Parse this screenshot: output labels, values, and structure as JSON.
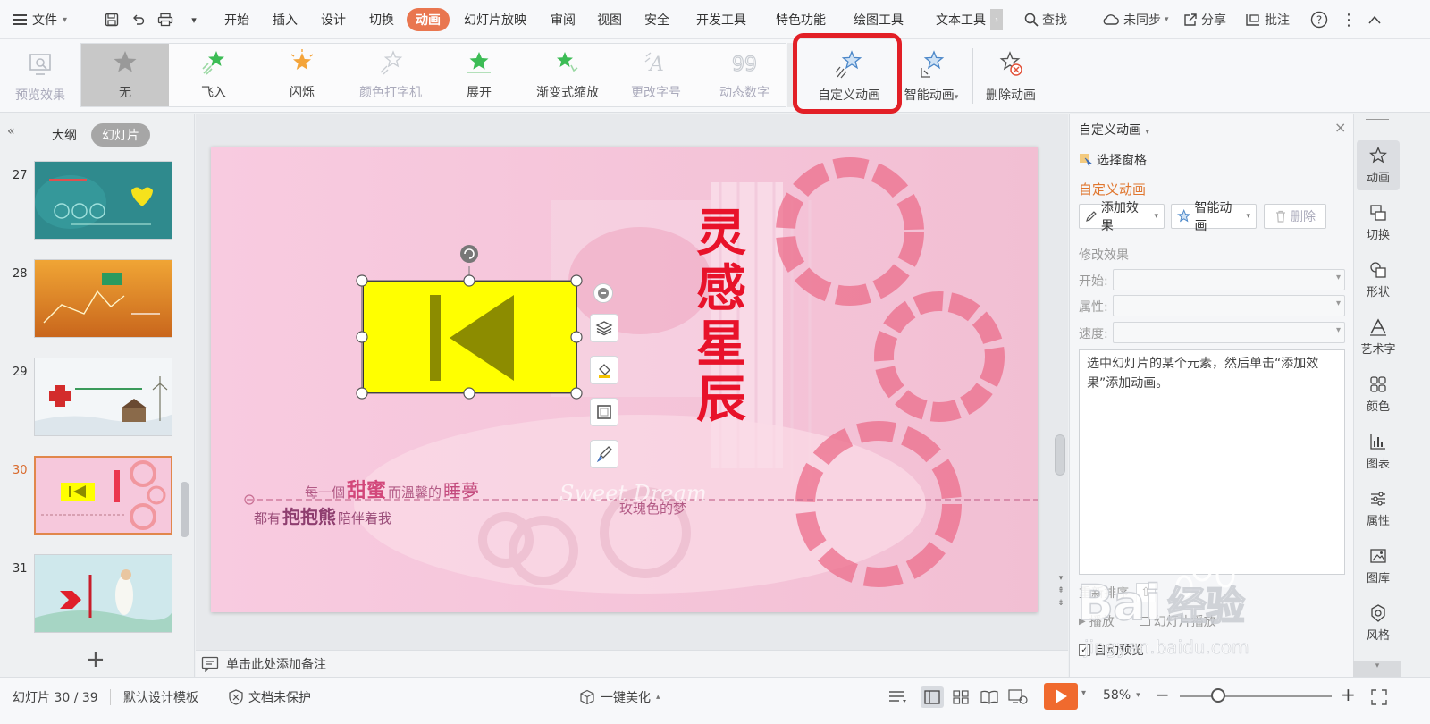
{
  "menubar": {
    "file_label": "文件",
    "tabs": [
      {
        "label": "开始",
        "active": false
      },
      {
        "label": "插入",
        "active": false
      },
      {
        "label": "设计",
        "active": false
      },
      {
        "label": "切换",
        "active": false
      },
      {
        "label": "动画",
        "active": true
      },
      {
        "label": "幻灯片放映",
        "active": false
      },
      {
        "label": "审阅",
        "active": false
      },
      {
        "label": "视图",
        "active": false
      },
      {
        "label": "安全",
        "active": false
      },
      {
        "label": "开发工具",
        "active": false
      },
      {
        "label": "特色功能",
        "active": false
      },
      {
        "label": "绘图工具",
        "active": false
      },
      {
        "label": "文本工具",
        "active": false
      }
    ],
    "search_label": "查找",
    "sync_label": "未同步",
    "share_label": "分享",
    "comment_label": "批注"
  },
  "ribbon": {
    "preview_label": "预览效果",
    "effects": [
      {
        "label": "无",
        "selected": true,
        "enabled": true
      },
      {
        "label": "飞入",
        "selected": false,
        "enabled": true
      },
      {
        "label": "闪烁",
        "selected": false,
        "enabled": true
      },
      {
        "label": "颜色打字机",
        "selected": false,
        "enabled": false
      },
      {
        "label": "展开",
        "selected": false,
        "enabled": true
      },
      {
        "label": "渐变式缩放",
        "selected": false,
        "enabled": true
      },
      {
        "label": "更改字号",
        "selected": false,
        "enabled": false
      },
      {
        "label": "动态数字",
        "selected": false,
        "enabled": false
      }
    ],
    "custom_animation_label": "自定义动画",
    "smart_animation_label": "智能动画",
    "delete_animation_label": "删除动画"
  },
  "left_panel": {
    "outline_label": "大纲",
    "slides_label": "幻灯片",
    "slides": [
      {
        "num": "27",
        "current": false
      },
      {
        "num": "28",
        "current": false
      },
      {
        "num": "29",
        "current": false
      },
      {
        "num": "30",
        "current": true
      },
      {
        "num": "31",
        "current": false
      }
    ]
  },
  "slide": {
    "title_vertical": "灵感星辰",
    "line1_a": "每一個",
    "line1_b": "甜蜜",
    "line1_c": "而溫馨的",
    "line1_d": "睡夢",
    "line2_a": "都有",
    "line2_b": "抱抱熊",
    "line2_c": "陪伴着我",
    "script_text": "Sweet Dream",
    "rose_text": "玫瑰色的梦"
  },
  "notes_placeholder": "单击此处添加备注",
  "right_pane": {
    "title": "自定义动画",
    "select_pane_label": "选择窗格",
    "section_title": "自定义动画",
    "add_effect_label": "添加效果",
    "smart_animation_label": "智能动画",
    "delete_label": "删除",
    "modify_label": "修改效果",
    "start_label": "开始:",
    "property_label": "属性:",
    "speed_label": "速度:",
    "hint_text": "选中幻灯片的某个元素，然后单击“添加效果”添加动画。",
    "reorder_label": "重新排序",
    "play_label": "播放",
    "slideshow_label": "幻灯片播放",
    "auto_preview_label": "自动预览",
    "auto_preview_checked": true
  },
  "rail": [
    {
      "label": "动画",
      "icon": "star-icon",
      "selected": true
    },
    {
      "label": "切换",
      "icon": "transition-icon",
      "selected": false
    },
    {
      "label": "形状",
      "icon": "shape-icon",
      "selected": false
    },
    {
      "label": "艺术字",
      "icon": "wordart-icon",
      "selected": false
    },
    {
      "label": "颜色",
      "icon": "color-icon",
      "selected": false
    },
    {
      "label": "图表",
      "icon": "chart-icon",
      "selected": false
    },
    {
      "label": "属性",
      "icon": "property-icon",
      "selected": false
    },
    {
      "label": "图库",
      "icon": "gallery-icon",
      "selected": false
    },
    {
      "label": "风格",
      "icon": "style-icon",
      "selected": false
    }
  ],
  "statusbar": {
    "slide_counter": "幻灯片 30 / 39",
    "template_label": "默认设计模板",
    "protect_label": "文档未保护",
    "beautify_label": "一键美化",
    "zoom_label": "58%"
  },
  "watermark": {
    "brand_a": "Bai",
    "brand_b": "经验",
    "url": "jingyan.baidu.com"
  },
  "colors": {
    "accent": "#e9764f",
    "highlight_ring": "#e21f26",
    "slide_bg": "#f6c8dc",
    "button_fill": "#ffff00",
    "button_glyph": "#8c8c00",
    "title_red": "#e8122a",
    "play": "#f06a2e"
  }
}
